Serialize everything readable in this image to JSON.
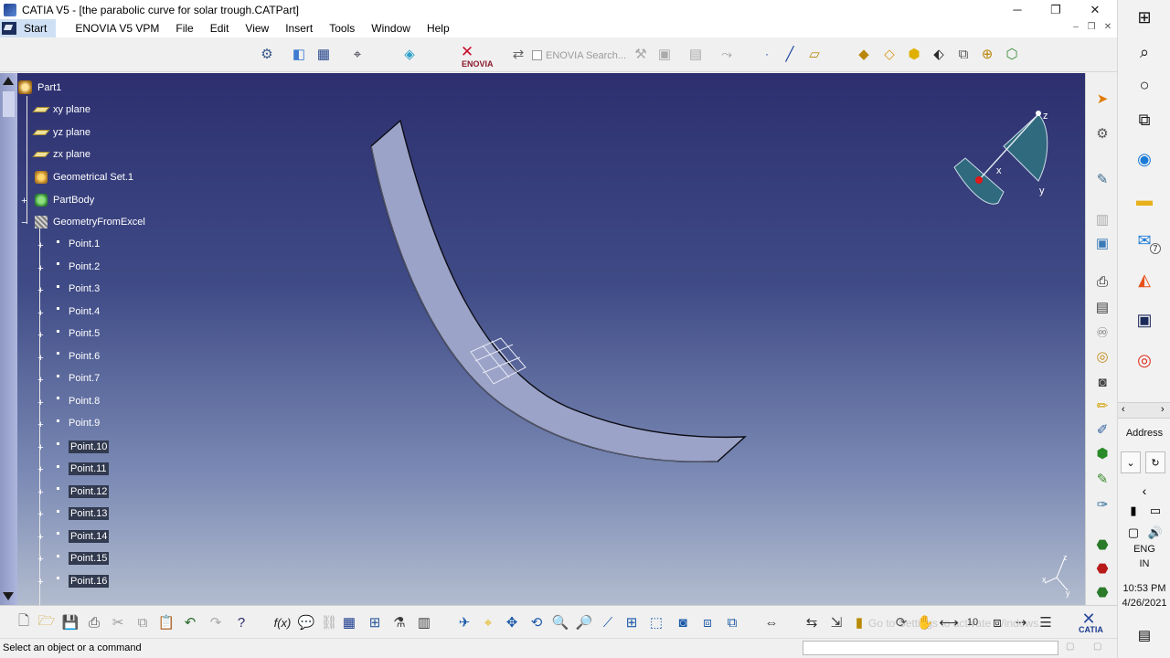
{
  "window": {
    "title": "CATIA V5 - [the parabolic curve for solar trough.CATPart]",
    "controls": {
      "minimize": "─",
      "maximize": "❐",
      "close": "✕"
    }
  },
  "menubar": {
    "start": "Start",
    "items": [
      "ENOVIA V5 VPM",
      "File",
      "Edit",
      "View",
      "Insert",
      "Tools",
      "Window",
      "Help"
    ],
    "mdi_controls": {
      "minimize": "–",
      "restore": "❐",
      "close": "✕"
    }
  },
  "toolbar": {
    "enovia_brand": "ENOVIA",
    "enovia_search": "ENOVIA Search..."
  },
  "tree": {
    "root": "Part1",
    "planes": [
      "xy plane",
      "yz plane",
      "zx plane"
    ],
    "geo_set": "Geometrical Set.1",
    "part_body": "PartBody",
    "excel_set": "GeometryFromExcel",
    "points": [
      "Point.1",
      "Point.2",
      "Point.3",
      "Point.4",
      "Point.5",
      "Point.6",
      "Point.7",
      "Point.8",
      "Point.9",
      "Point.10",
      "Point.11",
      "Point.12",
      "Point.13",
      "Point.14",
      "Point.15",
      "Point.16"
    ],
    "highlighted_from": 9
  },
  "compass": {
    "x": "x",
    "y": "y",
    "z": "z"
  },
  "axis_gizmo": {
    "z": "z",
    "y": "y",
    "x": "x"
  },
  "bottombar": {
    "watermark": "Go to Settings to activate Windows.",
    "catia_brand": "CATIA"
  },
  "status": {
    "message": "Select an object or a command"
  },
  "taskbar": {
    "address_label": "Address",
    "language": "ENG",
    "region": "IN",
    "time": "10:53 PM",
    "date": "4/26/2021",
    "mail_badge": "7"
  },
  "colors": {
    "viewport_top": "#2d2f6f",
    "viewport_bottom": "#b2bccf",
    "surface_fill": "#9ba3c8",
    "tree_highlight": "#323a4f",
    "compass_fill": "#2f6a7f"
  }
}
